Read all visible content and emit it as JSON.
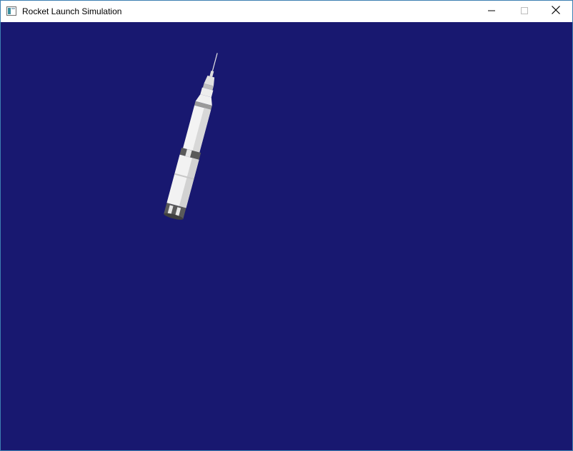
{
  "window": {
    "title": "Rocket Launch Simulation",
    "controls": {
      "minimize": "minimize-icon",
      "maximize": "maximize-icon",
      "close": "close-icon"
    }
  },
  "scene": {
    "background_color": "#181870",
    "object": "rocket",
    "rocket_colors": {
      "body": "#f2f2f2",
      "shade": "#c8c8c8",
      "band": "#555555"
    }
  }
}
